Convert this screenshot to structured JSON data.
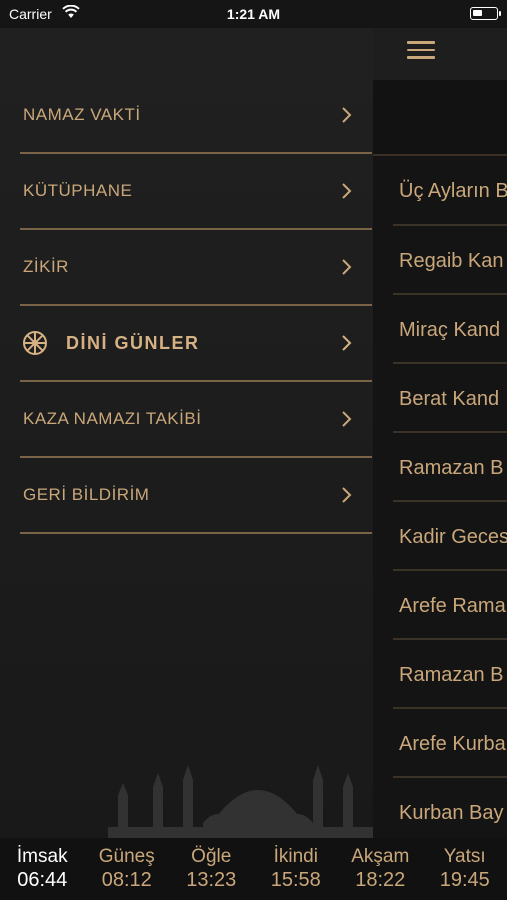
{
  "status_bar": {
    "carrier": "Carrier",
    "time": "1:21 AM"
  },
  "menu": {
    "items": [
      {
        "label": "NAMAZ VAKTİ",
        "active": false
      },
      {
        "label": "KÜTÜPHANE",
        "active": false
      },
      {
        "label": "ZİKİR",
        "active": false
      },
      {
        "label": "DİNİ GÜNLER",
        "active": true,
        "icon": "dharma-wheel-icon"
      },
      {
        "label": "KAZA NAMAZI TAKİBİ",
        "active": false
      },
      {
        "label": "GERİ BİLDİRİM",
        "active": false
      }
    ]
  },
  "main": {
    "days": [
      "Üç Ayların B",
      "Regaib Kan",
      "Miraç Kand",
      "Berat Kand",
      "Ramazan B",
      "Kadir Geces",
      "Arefe Rama",
      "Ramazan B",
      "Arefe Kurba",
      "Kurban Bay"
    ]
  },
  "prayer_times": [
    {
      "name": "İmsak",
      "time": "06:44",
      "current": true
    },
    {
      "name": "Güneş",
      "time": "08:12",
      "current": false
    },
    {
      "name": "Öğle",
      "time": "13:23",
      "current": false
    },
    {
      "name": "İkindi",
      "time": "15:58",
      "current": false
    },
    {
      "name": "Akşam",
      "time": "18:22",
      "current": false
    },
    {
      "name": "Yatsı",
      "time": "19:45",
      "current": false
    }
  ],
  "colors": {
    "accent": "#c9a77a",
    "divider": "#7a6448",
    "background": "#1a1a1a"
  }
}
